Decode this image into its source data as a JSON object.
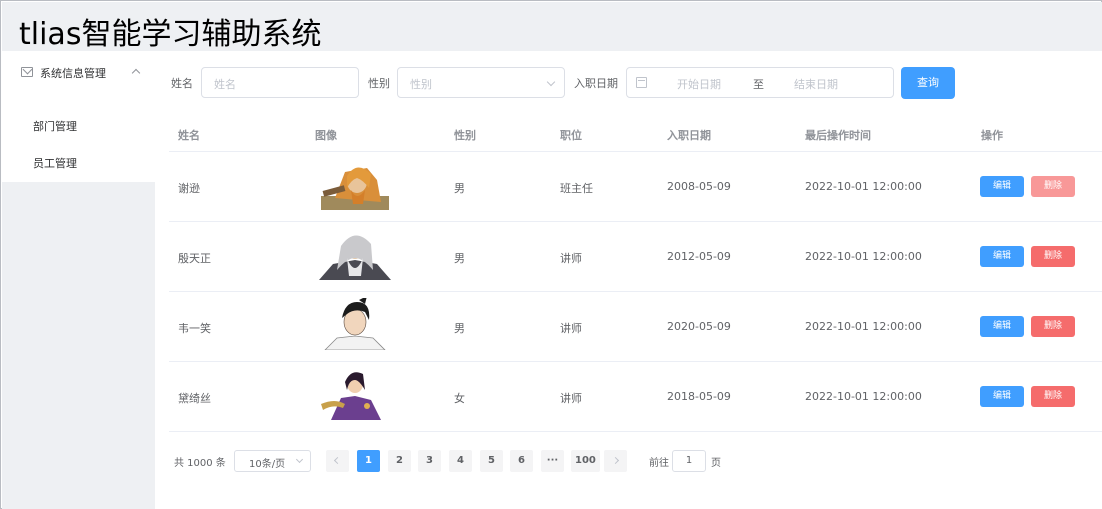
{
  "app": {
    "title": "tlias智能学习辅助系统"
  },
  "sidebar": {
    "group_label": "系统信息管理",
    "items": [
      {
        "label": "部门管理"
      },
      {
        "label": "员工管理"
      }
    ]
  },
  "filters": {
    "name_label": "姓名",
    "name_placeholder": "姓名",
    "gender_label": "性别",
    "gender_placeholder": "性别",
    "date_label": "入职日期",
    "start_placeholder": "开始日期",
    "range_sep": "至",
    "end_placeholder": "结束日期",
    "query_button": "查询"
  },
  "table": {
    "columns": [
      "姓名",
      "图像",
      "性别",
      "职位",
      "入职日期",
      "最后操作时间",
      "操作"
    ],
    "edit_label": "编辑",
    "delete_label": "删除",
    "rows": [
      {
        "name": "谢逊",
        "gender": "男",
        "job": "班主任",
        "entry_date": "2008-05-09",
        "update_time": "2022-10-01 12:00:00",
        "avatar": "orange-haired-warrior-portrait"
      },
      {
        "name": "殷天正",
        "gender": "男",
        "job": "讲师",
        "entry_date": "2012-05-09",
        "update_time": "2022-10-01 12:00:00",
        "avatar": "white-bearded-elder-portrait"
      },
      {
        "name": "韦一笑",
        "gender": "男",
        "job": "讲师",
        "entry_date": "2020-05-09",
        "update_time": "2022-10-01 12:00:00",
        "avatar": "black-haired-swordsman-portrait"
      },
      {
        "name": "黛绮丝",
        "gender": "女",
        "job": "讲师",
        "entry_date": "2018-05-09",
        "update_time": "2022-10-01 12:00:00",
        "avatar": "purple-robed-heroine-portrait"
      }
    ]
  },
  "pagination": {
    "total_text": "共 1000 条",
    "page_size": "10条/页",
    "pages": [
      "1",
      "2",
      "3",
      "4",
      "5",
      "6",
      "···",
      "100"
    ],
    "current_page": "1",
    "jump_prefix": "前往",
    "jump_value": "1",
    "jump_suffix": "页"
  },
  "colors": {
    "primary": "#409eff",
    "danger": "#f56c6c",
    "danger_light": "#f89898",
    "chrome": "#eef0f3"
  }
}
